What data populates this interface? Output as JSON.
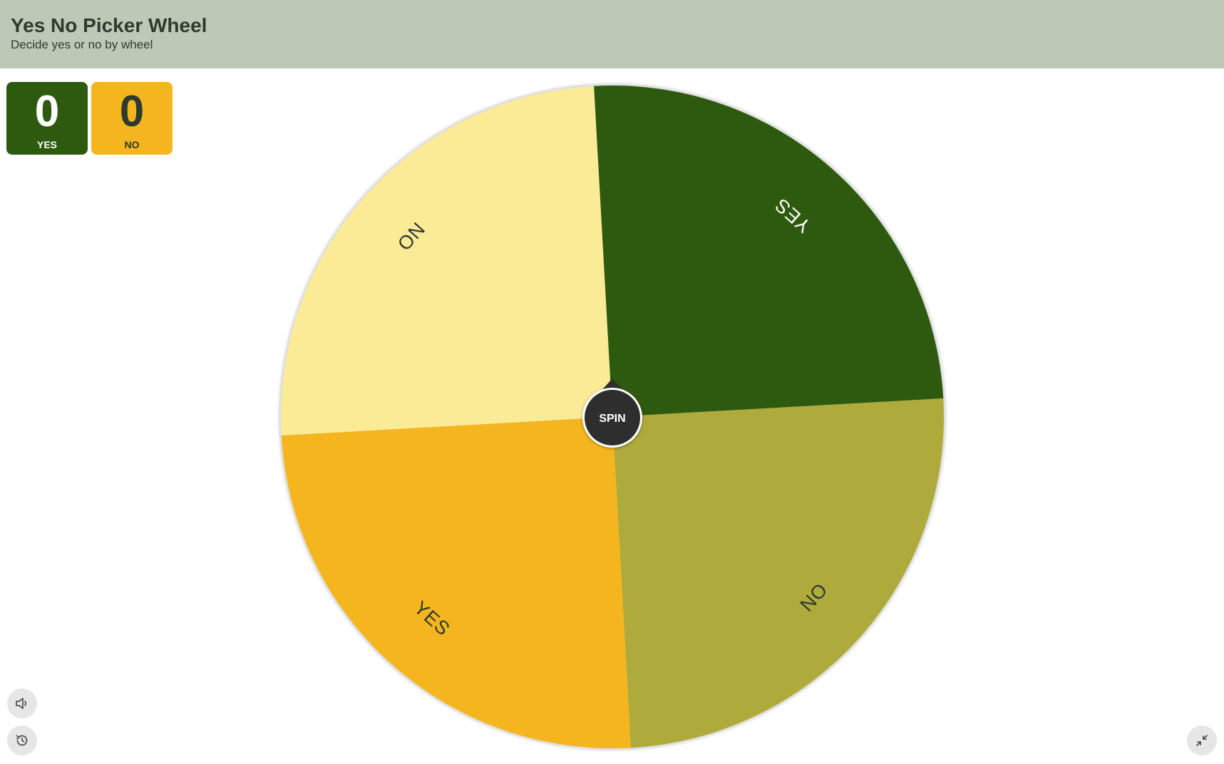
{
  "header": {
    "title": "Yes No Picker Wheel",
    "subtitle": "Decide yes or no by wheel",
    "background": "#bcc9b6"
  },
  "scoreboard": {
    "yes": {
      "count": "0",
      "label": "YES",
      "color": "#2d5a0e"
    },
    "no": {
      "count": "0",
      "label": "NO",
      "color": "#f5b51f"
    }
  },
  "wheel": {
    "segments": [
      {
        "label": "YES",
        "color": "#2d5a0e",
        "text_color": "#ffffff"
      },
      {
        "label": "NO",
        "color": "#aeaa3b",
        "text_color": "#2f3a2f"
      },
      {
        "label": "YES",
        "color": "#f5b51f",
        "text_color": "#2f3a2f"
      },
      {
        "label": "NO",
        "color": "#fbeb97",
        "text_color": "#2f3a2f"
      }
    ],
    "spin_button": {
      "label": "SPIN",
      "color": "#2e2e2e"
    }
  },
  "controls": {
    "sound_icon": "speaker-icon",
    "history_icon": "history-icon",
    "collapse_icon": "collapse-icon"
  }
}
